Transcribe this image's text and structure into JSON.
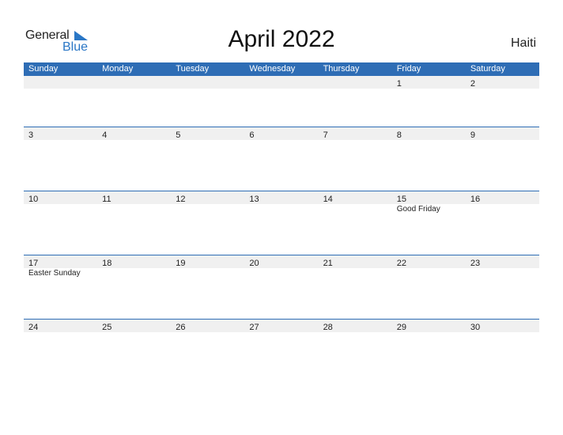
{
  "logo": {
    "word1": "General",
    "word2": "Blue",
    "accent_color": "#2a77c6"
  },
  "title": "April 2022",
  "country": "Haiti",
  "header_color": "#2e6db5",
  "weekdays": [
    "Sunday",
    "Monday",
    "Tuesday",
    "Wednesday",
    "Thursday",
    "Friday",
    "Saturday"
  ],
  "weeks": [
    {
      "days": [
        {
          "num": "",
          "holiday": ""
        },
        {
          "num": "",
          "holiday": ""
        },
        {
          "num": "",
          "holiday": ""
        },
        {
          "num": "",
          "holiday": ""
        },
        {
          "num": "",
          "holiday": ""
        },
        {
          "num": "1",
          "holiday": ""
        },
        {
          "num": "2",
          "holiday": ""
        }
      ]
    },
    {
      "days": [
        {
          "num": "3",
          "holiday": ""
        },
        {
          "num": "4",
          "holiday": ""
        },
        {
          "num": "5",
          "holiday": ""
        },
        {
          "num": "6",
          "holiday": ""
        },
        {
          "num": "7",
          "holiday": ""
        },
        {
          "num": "8",
          "holiday": ""
        },
        {
          "num": "9",
          "holiday": ""
        }
      ]
    },
    {
      "days": [
        {
          "num": "10",
          "holiday": ""
        },
        {
          "num": "11",
          "holiday": ""
        },
        {
          "num": "12",
          "holiday": ""
        },
        {
          "num": "13",
          "holiday": ""
        },
        {
          "num": "14",
          "holiday": ""
        },
        {
          "num": "15",
          "holiday": "Good Friday"
        },
        {
          "num": "16",
          "holiday": ""
        }
      ]
    },
    {
      "days": [
        {
          "num": "17",
          "holiday": "Easter Sunday"
        },
        {
          "num": "18",
          "holiday": ""
        },
        {
          "num": "19",
          "holiday": ""
        },
        {
          "num": "20",
          "holiday": ""
        },
        {
          "num": "21",
          "holiday": ""
        },
        {
          "num": "22",
          "holiday": ""
        },
        {
          "num": "23",
          "holiday": ""
        }
      ]
    },
    {
      "days": [
        {
          "num": "24",
          "holiday": ""
        },
        {
          "num": "25",
          "holiday": ""
        },
        {
          "num": "26",
          "holiday": ""
        },
        {
          "num": "27",
          "holiday": ""
        },
        {
          "num": "28",
          "holiday": ""
        },
        {
          "num": "29",
          "holiday": ""
        },
        {
          "num": "30",
          "holiday": ""
        }
      ]
    }
  ]
}
